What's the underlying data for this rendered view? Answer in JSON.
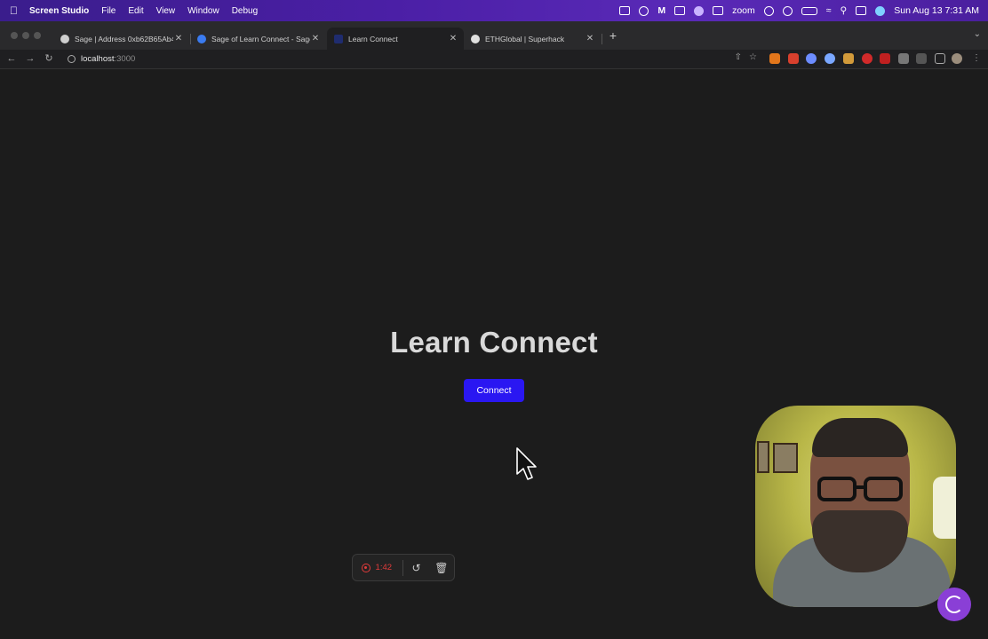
{
  "menubar": {
    "app_name": "Screen Studio",
    "menus": [
      "File",
      "Edit",
      "View",
      "Window",
      "Debug"
    ],
    "zoom_label": "zoom",
    "datetime": "Sun Aug 13  7:31 AM"
  },
  "tabs": [
    {
      "title": "Sage | Address 0xb62B65Ab4",
      "active": false
    },
    {
      "title": "Sage of Learn Connect - Sage",
      "active": false
    },
    {
      "title": "Learn Connect",
      "active": true
    },
    {
      "title": "ETHGlobal | Superhack",
      "active": false
    }
  ],
  "address": {
    "host": "localhost",
    "port": ":3000"
  },
  "page": {
    "heading": "Learn Connect",
    "connect_label": "Connect"
  },
  "recording": {
    "time": "1:42"
  },
  "colors": {
    "accent_button": "#2a17f2",
    "recording_red": "#e13b3b",
    "menubar_purple": "#4b1fa6"
  }
}
